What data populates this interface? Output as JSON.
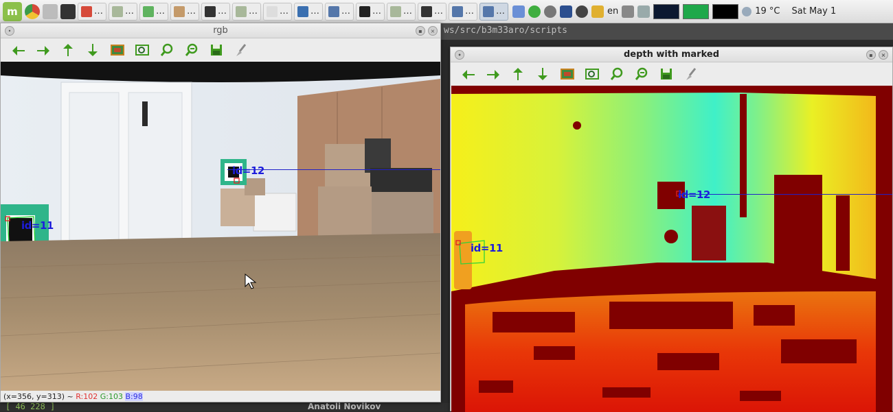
{
  "panel": {
    "menu_icon": "mint-menu-icon",
    "tasks": [
      {
        "label": "…",
        "icon": "chrome-icon",
        "color": "#d64a3a"
      },
      {
        "label": "…",
        "icon": "folder-icon",
        "color": "#a8b89a"
      },
      {
        "label": "…",
        "icon": "chat-icon",
        "color": "#5fb35f"
      },
      {
        "label": "…",
        "icon": "editor-icon",
        "color": "#c49a6a"
      },
      {
        "label": "…",
        "icon": "terminal-icon",
        "color": "#333333"
      },
      {
        "label": "…",
        "icon": "folder-icon",
        "color": "#a8b89a"
      },
      {
        "label": "…",
        "icon": "document-icon",
        "color": "#dddddd"
      },
      {
        "label": "…",
        "icon": "thunderbird-icon",
        "color": "#3a6fb0"
      },
      {
        "label": "…",
        "icon": "window-icon",
        "color": "#5577aa"
      },
      {
        "label": "…",
        "icon": "pycharm-icon",
        "color": "#222222"
      },
      {
        "label": "…",
        "icon": "folder-icon",
        "color": "#a8b89a"
      },
      {
        "label": "…",
        "icon": "terminal-icon",
        "color": "#333333"
      },
      {
        "label": "…",
        "icon": "window-icon",
        "color": "#5577aa"
      },
      {
        "label": "…",
        "icon": "window-icon",
        "color": "#5577aa"
      }
    ],
    "tray": {
      "language": "en",
      "temperature": "19 °C",
      "clock": "Sat May 1"
    }
  },
  "background": {
    "terminal_path": "ws/src/b3m33aro/scripts",
    "bottom_left": "[  46   228 ]",
    "bottom_name": "Anatoli Novikov"
  },
  "rgb_window": {
    "title": "rgb",
    "status": {
      "coords": "(x=356, y=313) ~",
      "r": "R:102",
      "g": "G:103",
      "b": "B:98"
    },
    "markers": [
      {
        "label": "id=11"
      },
      {
        "label": "id=12"
      }
    ]
  },
  "depth_window": {
    "title": "depth with marked",
    "markers": [
      {
        "label": "id=11"
      },
      {
        "label": "id=12"
      }
    ]
  },
  "toolbar_icons": [
    "arrow-left-icon",
    "arrow-right-icon",
    "arrow-up-icon",
    "arrow-down-icon",
    "image-icon",
    "zoom-region-icon",
    "zoom-in-icon",
    "zoom-out-icon",
    "save-icon",
    "brush-icon"
  ],
  "colors": {
    "marker_text": "#1d1ddc",
    "status_r": "#e03030",
    "status_g": "#2a9a2a",
    "status_b": "#2e2ee0",
    "tool_green": "#3f9a1e"
  }
}
